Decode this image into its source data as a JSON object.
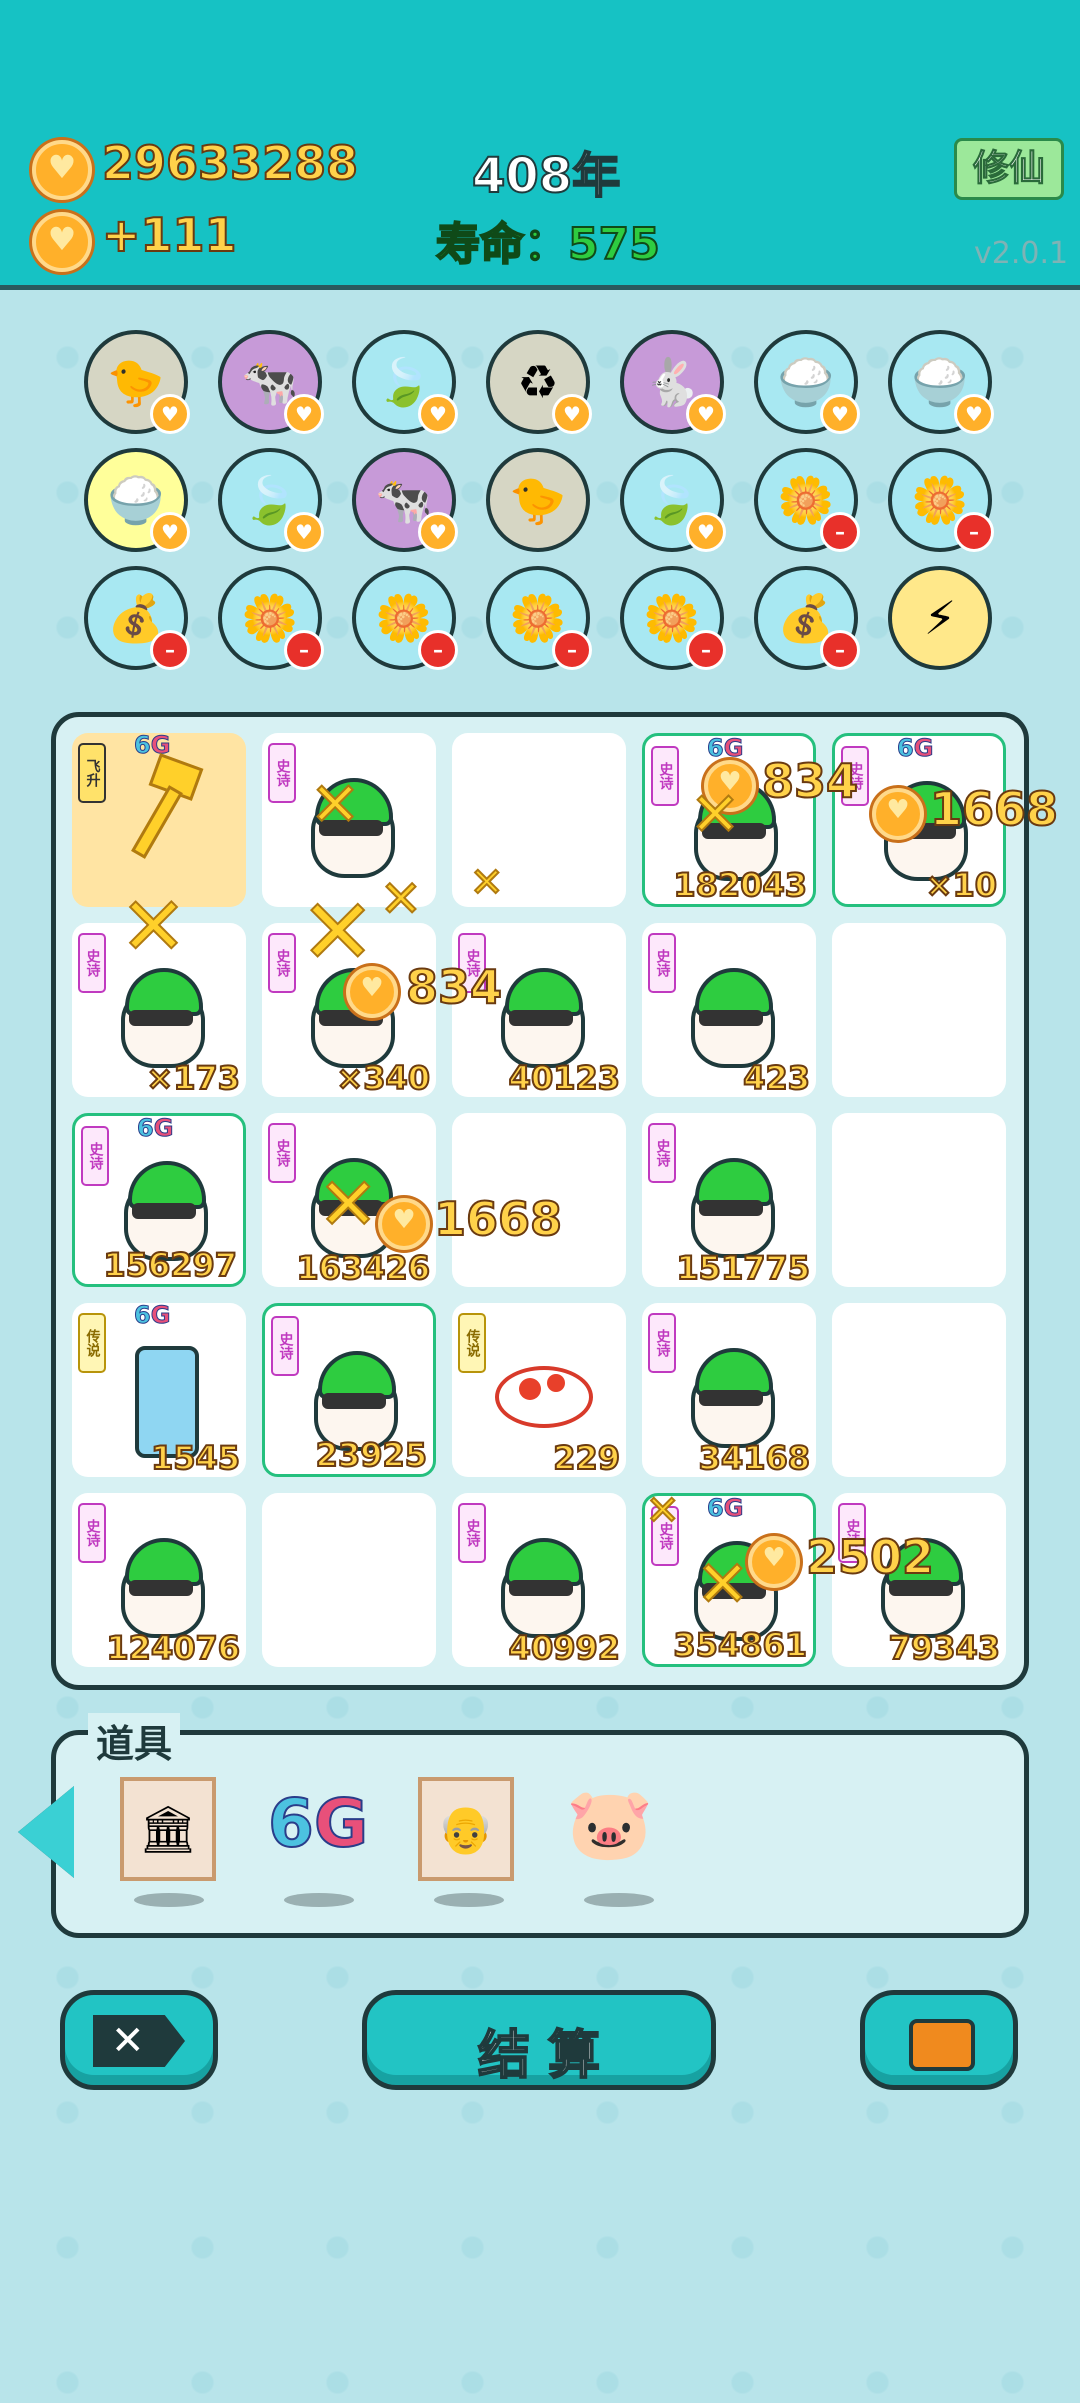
{
  "header": {
    "coins": "29633288",
    "income": "+111",
    "year": "408年",
    "lifespan": "寿命：575",
    "mode_button": "修仙",
    "version": "v2.0.1"
  },
  "props": {
    "title": "道具",
    "items": [
      "scroll-frame",
      "6G",
      "elder-portrait",
      "piggy-bank"
    ]
  },
  "buttons": {
    "settle": "结 算"
  },
  "icons_row1": [
    "chick-egg",
    "cows",
    "leaf",
    "recycle",
    "rabbit",
    "rice-bowl",
    "rice-bowl"
  ],
  "icons_row2": [
    "rice-bowl",
    "leaf",
    "cows",
    "chick-egg",
    "leaf",
    "flower-pot",
    "flower-pot"
  ],
  "icons_row3": [
    "money-bag",
    "flower-pot",
    "flower-pot",
    "flower-pot",
    "flower-pot",
    "money-bag",
    "lightning"
  ],
  "grid": [
    {
      "tag": "飞升",
      "g6": true,
      "num": "",
      "kind": "gold"
    },
    {
      "tag": "史诗",
      "num": "",
      "kind": "plain"
    },
    {
      "tag": "",
      "num": "",
      "kind": "empty"
    },
    {
      "tag": "史诗",
      "g6": true,
      "num": "182043",
      "kind": "hl"
    },
    {
      "tag": "史诗",
      "g6": true,
      "num": "×10",
      "kind": "hl"
    },
    {
      "tag": "史诗",
      "num": "×173",
      "kind": "plain"
    },
    {
      "tag": "史诗",
      "num": "×340",
      "kind": "plain"
    },
    {
      "tag": "史诗",
      "num": "40123",
      "kind": "plain"
    },
    {
      "tag": "史诗",
      "num": "423",
      "kind": "plain"
    },
    {
      "tag": "",
      "num": "",
      "kind": "empty"
    },
    {
      "tag": "史诗",
      "g6": true,
      "num": "156297",
      "kind": "hl"
    },
    {
      "tag": "史诗",
      "num": "163426",
      "kind": "plain"
    },
    {
      "tag": "",
      "num": "",
      "kind": "empty"
    },
    {
      "tag": "史诗",
      "num": "151775",
      "kind": "plain"
    },
    {
      "tag": "",
      "num": "",
      "kind": "empty"
    },
    {
      "tag": "传说",
      "g6": true,
      "num": "1545",
      "kind": "fridge"
    },
    {
      "tag": "史诗",
      "num": "23925",
      "kind": "hl"
    },
    {
      "tag": "传说",
      "num": "229",
      "kind": "koi"
    },
    {
      "tag": "史诗",
      "num": "34168",
      "kind": "plain"
    },
    {
      "tag": "",
      "num": "",
      "kind": "empty"
    },
    {
      "tag": "史诗",
      "num": "124076",
      "kind": "plain"
    },
    {
      "tag": "",
      "num": "",
      "kind": "empty"
    },
    {
      "tag": "史诗",
      "num": "40992",
      "kind": "plain"
    },
    {
      "tag": "史诗",
      "g6": true,
      "num": "354861",
      "kind": "hl"
    },
    {
      "tag": "史诗",
      "num": "79343",
      "kind": "plain"
    }
  ],
  "floating": [
    "834",
    "1668",
    "834",
    "1668",
    "2502"
  ],
  "colors": {
    "top": "#16c2c4",
    "bg": "#b8e4ea",
    "gold": "#ffd24a",
    "green": "#2ecc40"
  }
}
